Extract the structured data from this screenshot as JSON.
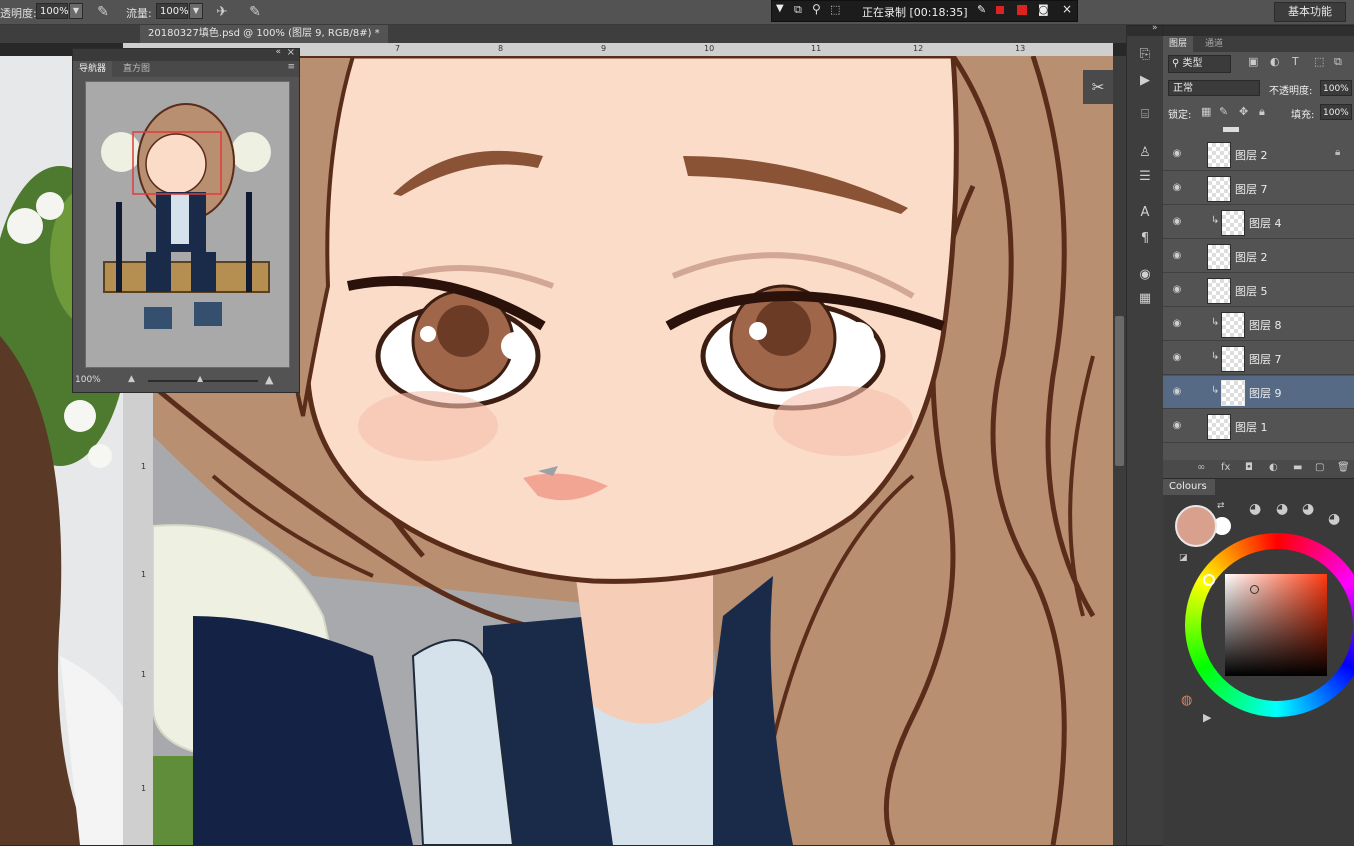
{
  "options_bar": {
    "opacity_label": "透明度:",
    "opacity_value": "100%",
    "flow_label": "流量:",
    "flow_value": "100%",
    "workspace_label": "基本功能"
  },
  "recording": {
    "status_text": "正在录制 [00:18:35]"
  },
  "document": {
    "tab_title": "20180327填色.psd @ 100% (图层 9, RGB/8#) *",
    "tab_close": "×",
    "ruler_ticks": [
      "7",
      "8",
      "9",
      "10",
      "11",
      "12",
      "13"
    ],
    "vruler_ticks": [
      "1",
      "1",
      "1",
      "1"
    ]
  },
  "navigator": {
    "tabs": [
      "导航器",
      "直方图"
    ],
    "zoom_value": "100%"
  },
  "layers_panel": {
    "tabs": [
      "图层",
      "通道"
    ],
    "kind_filter": "类型",
    "blend_mode": "正常",
    "opacity_label": "不透明度:",
    "opacity_value": "100%",
    "lock_label": "锁定:",
    "fill_label": "填充:",
    "fill_value": "100%",
    "layers": [
      {
        "name": "图层 2",
        "clipped": false,
        "locked": true,
        "selected": false
      },
      {
        "name": "图层 7",
        "clipped": false,
        "locked": false,
        "selected": false
      },
      {
        "name": "图层 4",
        "clipped": true,
        "locked": false,
        "selected": false
      },
      {
        "name": "图层 2",
        "clipped": false,
        "locked": false,
        "selected": false
      },
      {
        "name": "图层 5",
        "clipped": false,
        "locked": false,
        "selected": false
      },
      {
        "name": "图层 8",
        "clipped": true,
        "locked": false,
        "selected": false
      },
      {
        "name": "图层 7",
        "clipped": true,
        "locked": false,
        "selected": false
      },
      {
        "name": "图层 9",
        "clipped": true,
        "locked": false,
        "selected": true
      },
      {
        "name": "图层 1",
        "clipped": false,
        "locked": false,
        "selected": false
      }
    ]
  },
  "colours_panel": {
    "title": "Colours",
    "foreground_color": "#d9a08e",
    "background_color": "#ffffff"
  },
  "colors": {
    "skin": "#fbdcc8",
    "hair": "#b98f72",
    "outline": "#5a2c1a",
    "selected_layer": "#566a86"
  }
}
